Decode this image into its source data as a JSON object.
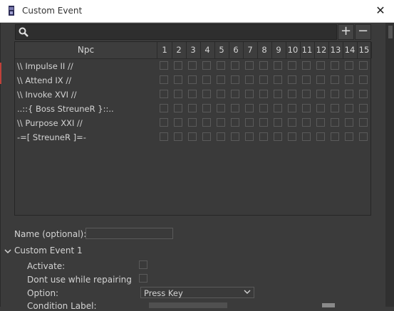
{
  "window": {
    "title": "Custom Event"
  },
  "toolbar": {
    "search_placeholder": "",
    "add_label": "+",
    "remove_label": "−"
  },
  "table": {
    "header_npc": "Npc",
    "columns": [
      "1",
      "2",
      "3",
      "4",
      "5",
      "6",
      "7",
      "8",
      "9",
      "10",
      "11",
      "12",
      "13",
      "14",
      "15"
    ],
    "rows": [
      "\\\\ Impulse II //",
      "\\\\ Attend IX //",
      "\\\\ Invoke XVI //",
      "..::{ Boss StreuneR }::..",
      "\\\\ Purpose XXI //",
      "-=[ StreuneR ]=-"
    ]
  },
  "form": {
    "name_label": "Name (optional):",
    "name_value": "",
    "section_label": "Custom Event 1",
    "activate_label": "Activate:",
    "dont_use_label": "Dont use while repairing",
    "option_label": "Option:",
    "option_value": "Press Key",
    "condition_label": "Condition Label:"
  }
}
